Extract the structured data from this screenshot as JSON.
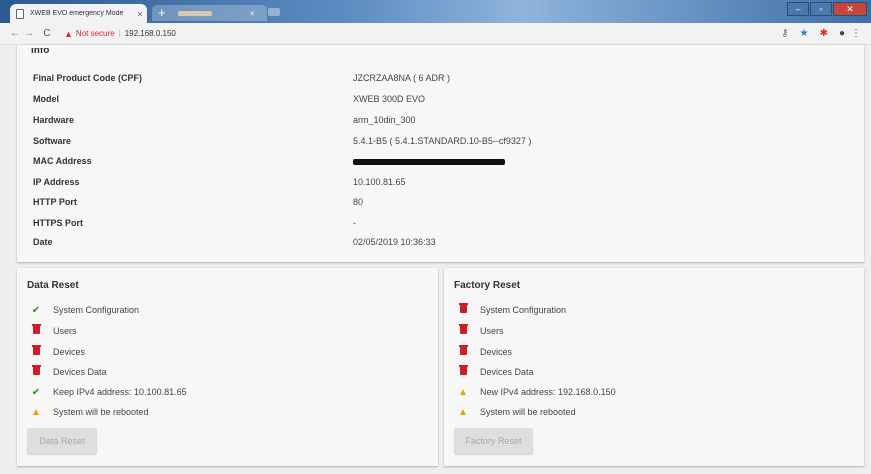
{
  "browser": {
    "tab_title": "XWEB EVO emergency Mode",
    "tab_close": "×",
    "new_tab": "+",
    "back": "←",
    "forward": "→",
    "reload": "C",
    "warning": "▲",
    "not_secure": "Not secure",
    "separator": "|",
    "url": "192.168.0.150",
    "key_icon": "key-icon",
    "star_icon": "star-icon",
    "extension_icon": "extension-icon",
    "profile_icon": "profile-icon",
    "menu_icon": "menu-icon"
  },
  "info": {
    "heading": "Info",
    "rows": [
      {
        "label": "Final Product Code (CPF)",
        "value": "JZCRZAA8NA ( 6 ADR )"
      },
      {
        "label": "Model",
        "value": "XWEB 300D EVO"
      },
      {
        "label": "Hardware",
        "value": "arm_10din_300"
      },
      {
        "label": "Software",
        "value": "5.4.1-B5 ( 5.4.1.STANDARD.10-B5--cf9327 )"
      },
      {
        "label": "MAC Address",
        "value": ""
      },
      {
        "label": "IP Address",
        "value": "10.100.81.65"
      },
      {
        "label": "HTTP Port",
        "value": "80"
      },
      {
        "label": "HTTPS Port",
        "value": "-"
      },
      {
        "label": "Date",
        "value": "02/05/2019 10:36:33"
      }
    ]
  },
  "data_reset": {
    "title": "Data Reset",
    "items": [
      {
        "icon": "check-icon",
        "text": "System Configuration"
      },
      {
        "icon": "trash-icon",
        "text": "Users"
      },
      {
        "icon": "trash-icon",
        "text": "Devices"
      },
      {
        "icon": "trash-icon",
        "text": "Devices Data"
      },
      {
        "icon": "check-icon",
        "text": "Keep IPv4 address: 10.100.81.65"
      },
      {
        "icon": "warning-icon",
        "text": "System will be rebooted"
      }
    ],
    "button": "Data Reset"
  },
  "factory_reset": {
    "title": "Factory Reset",
    "items": [
      {
        "icon": "trash-icon",
        "text": "System Configuration"
      },
      {
        "icon": "trash-icon",
        "text": "Users"
      },
      {
        "icon": "trash-icon",
        "text": "Devices"
      },
      {
        "icon": "trash-icon",
        "text": "Devices Data"
      },
      {
        "icon": "warning-icon",
        "text": "New IPv4 address: 192.168.0.150"
      },
      {
        "icon": "warning-icon",
        "text": "System will be rebooted"
      }
    ],
    "button": "Factory Reset"
  },
  "colors": {
    "check": "#2e8b2e",
    "trash": "#d01c28",
    "warning": "#f5a000",
    "not_secure": "#d32f2f"
  }
}
